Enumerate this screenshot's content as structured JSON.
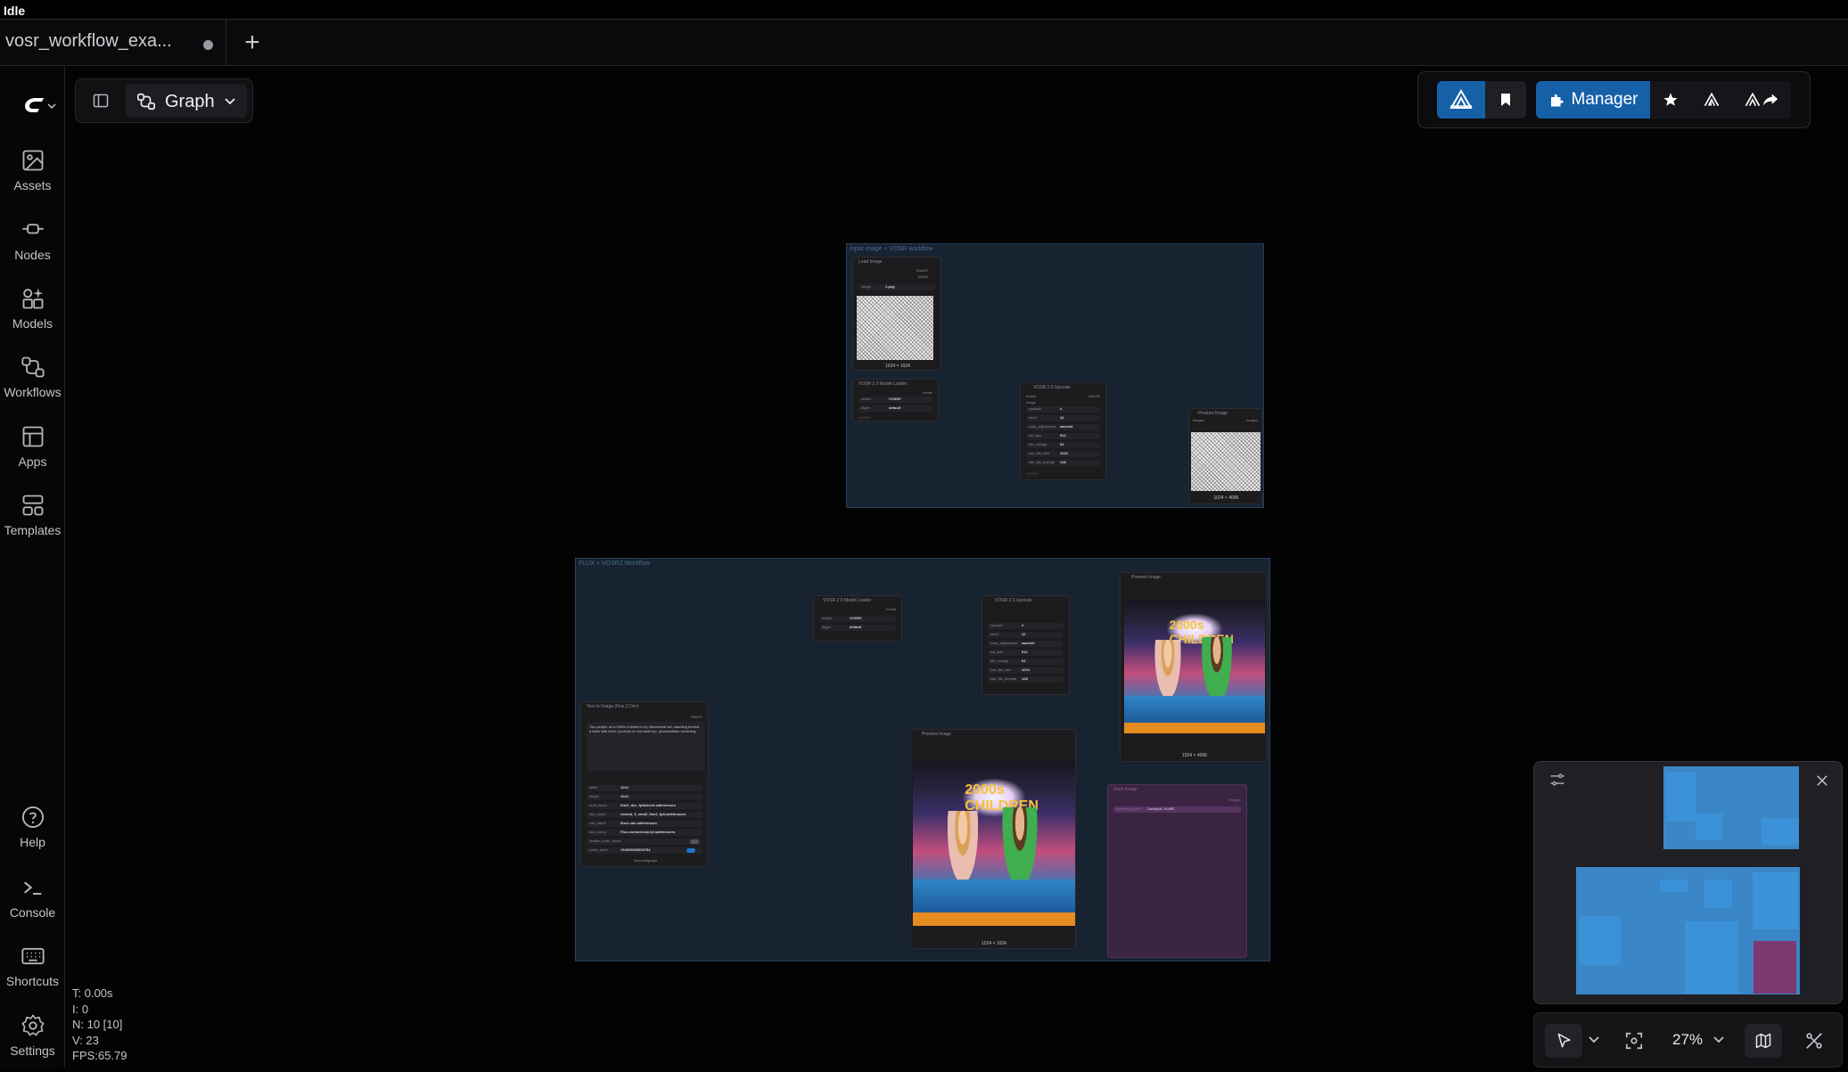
{
  "window": {
    "status": "Idle"
  },
  "tabs": [
    {
      "label": "vosr_workflow_exa...",
      "unsaved": true
    }
  ],
  "sidebar": {
    "items": [
      {
        "label": "Assets",
        "icon": "assets-icon"
      },
      {
        "label": "Nodes",
        "icon": "nodes-icon"
      },
      {
        "label": "Models",
        "icon": "models-icon"
      },
      {
        "label": "Workflows",
        "icon": "workflows-icon"
      },
      {
        "label": "Apps",
        "icon": "apps-icon"
      },
      {
        "label": "Templates",
        "icon": "templates-icon"
      }
    ],
    "bottom_items": [
      {
        "label": "Help",
        "icon": "help-icon"
      },
      {
        "label": "Console",
        "icon": "console-icon"
      },
      {
        "label": "Shortcuts",
        "icon": "keyboard-icon"
      },
      {
        "label": "Settings",
        "icon": "gear-icon"
      }
    ]
  },
  "graph_toolbar": {
    "mode_label": "Graph"
  },
  "top_right_toolbar": {
    "manager_label": "Manager",
    "accent": "#0e3d6a"
  },
  "groups": [
    {
      "title": "Input image + VOSR workflow",
      "nodes": {
        "load_image": {
          "title": "Load Image",
          "image_label": "image",
          "image_value": "1.png",
          "caption": "1024 × 1024",
          "outputs": [
            "IMAGE",
            "MASK"
          ]
        },
        "model_loader": {
          "title": "VOSR 2.0 Model Loader",
          "rows": [
            {
              "k": "model",
              "v": "VOSR2"
            },
            {
              "k": "dtype",
              "v": "default"
            }
          ],
          "output": "model",
          "footer": "VOSR2"
        },
        "upscale": {
          "title": "VOSR 2.0 Upscale",
          "inputs": [
            "model",
            "image"
          ],
          "output": "IMAGE",
          "rows": [
            {
              "k": "upscale",
              "v": "4"
            },
            {
              "k": "seed",
              "v": "42"
            },
            {
              "k": "color_adjustment",
              "v": "wavelet"
            },
            {
              "k": "tile_size",
              "v": "512"
            },
            {
              "k": "tile_overlap",
              "v": "64"
            },
            {
              "k": "vae_tile_size",
              "v": "1024"
            },
            {
              "k": "vae_tile_overlap",
              "v": "128"
            }
          ],
          "footer": "VOSR2"
        },
        "preview": {
          "title": "Preview Image",
          "input": "images",
          "output": "images",
          "caption": "1024 × 4096"
        }
      }
    },
    {
      "title": "FLUX + VOSR2 Workflow",
      "nodes": {
        "text_to_image": {
          "title": "Text to Image (Flux.2 Dev)",
          "prompt": "Two people on a 2000s children's toy infomercial set, standing behind a table with three products on the table top, photorealistic rendering",
          "output": "IMAGE",
          "rows": [
            {
              "k": "width",
              "v": "1024"
            },
            {
              "k": "height",
              "v": "1024"
            },
            {
              "k": "unet_name",
              "v": "flux2_dev_fp8mixed.safetensors"
            },
            {
              "k": "clip_name",
              "v": "mistral_3_small_flux2_fp8.safetensors"
            },
            {
              "k": "vae_name",
              "v": "flux2-vae.safetensors"
            },
            {
              "k": "lora_name",
              "v": "Flux-commercial-lyf.safetensors"
            },
            {
              "k": "enable_turbo_mode",
              "v": ""
            },
            {
              "k": "noise_seed",
              "v": "194693650603754"
            }
          ],
          "subgraph_label": "View subgraph"
        },
        "model_loader": {
          "title": "VOSR 2.0 Model Loader",
          "rows": [
            {
              "k": "model",
              "v": "VOSR2"
            },
            {
              "k": "dtype",
              "v": "default"
            }
          ],
          "output": "model"
        },
        "upscale": {
          "title": "VOSR 2.0 Upscale",
          "rows": [
            {
              "k": "upscale",
              "v": "4"
            },
            {
              "k": "seed",
              "v": "42"
            },
            {
              "k": "color_adjustment",
              "v": "wavelet"
            },
            {
              "k": "tile_size",
              "v": "512"
            },
            {
              "k": "tile_overlap",
              "v": "64"
            },
            {
              "k": "vae_tile_size",
              "v": "1024"
            },
            {
              "k": "vae_tile_overlap",
              "v": "128"
            }
          ]
        },
        "preview_top": {
          "title": "Preview Image",
          "caption": "1024 × 4096"
        },
        "preview_bottom": {
          "title": "Preview Image",
          "caption": "1024 × 1024"
        },
        "save_image": {
          "title": "Save Image",
          "filename_prefix_label": "filename_prefix",
          "filename_prefix_value": "ComfyUI_VOSR",
          "output": "images"
        }
      }
    }
  ],
  "poster_text": "2000s CHILDREN",
  "zoom": {
    "label": "27%"
  },
  "stats": {
    "t": "T: 0.00s",
    "i": "I: 0",
    "n": "N: 10 [10]",
    "v": "V: 23",
    "fps": "FPS:65.79"
  }
}
